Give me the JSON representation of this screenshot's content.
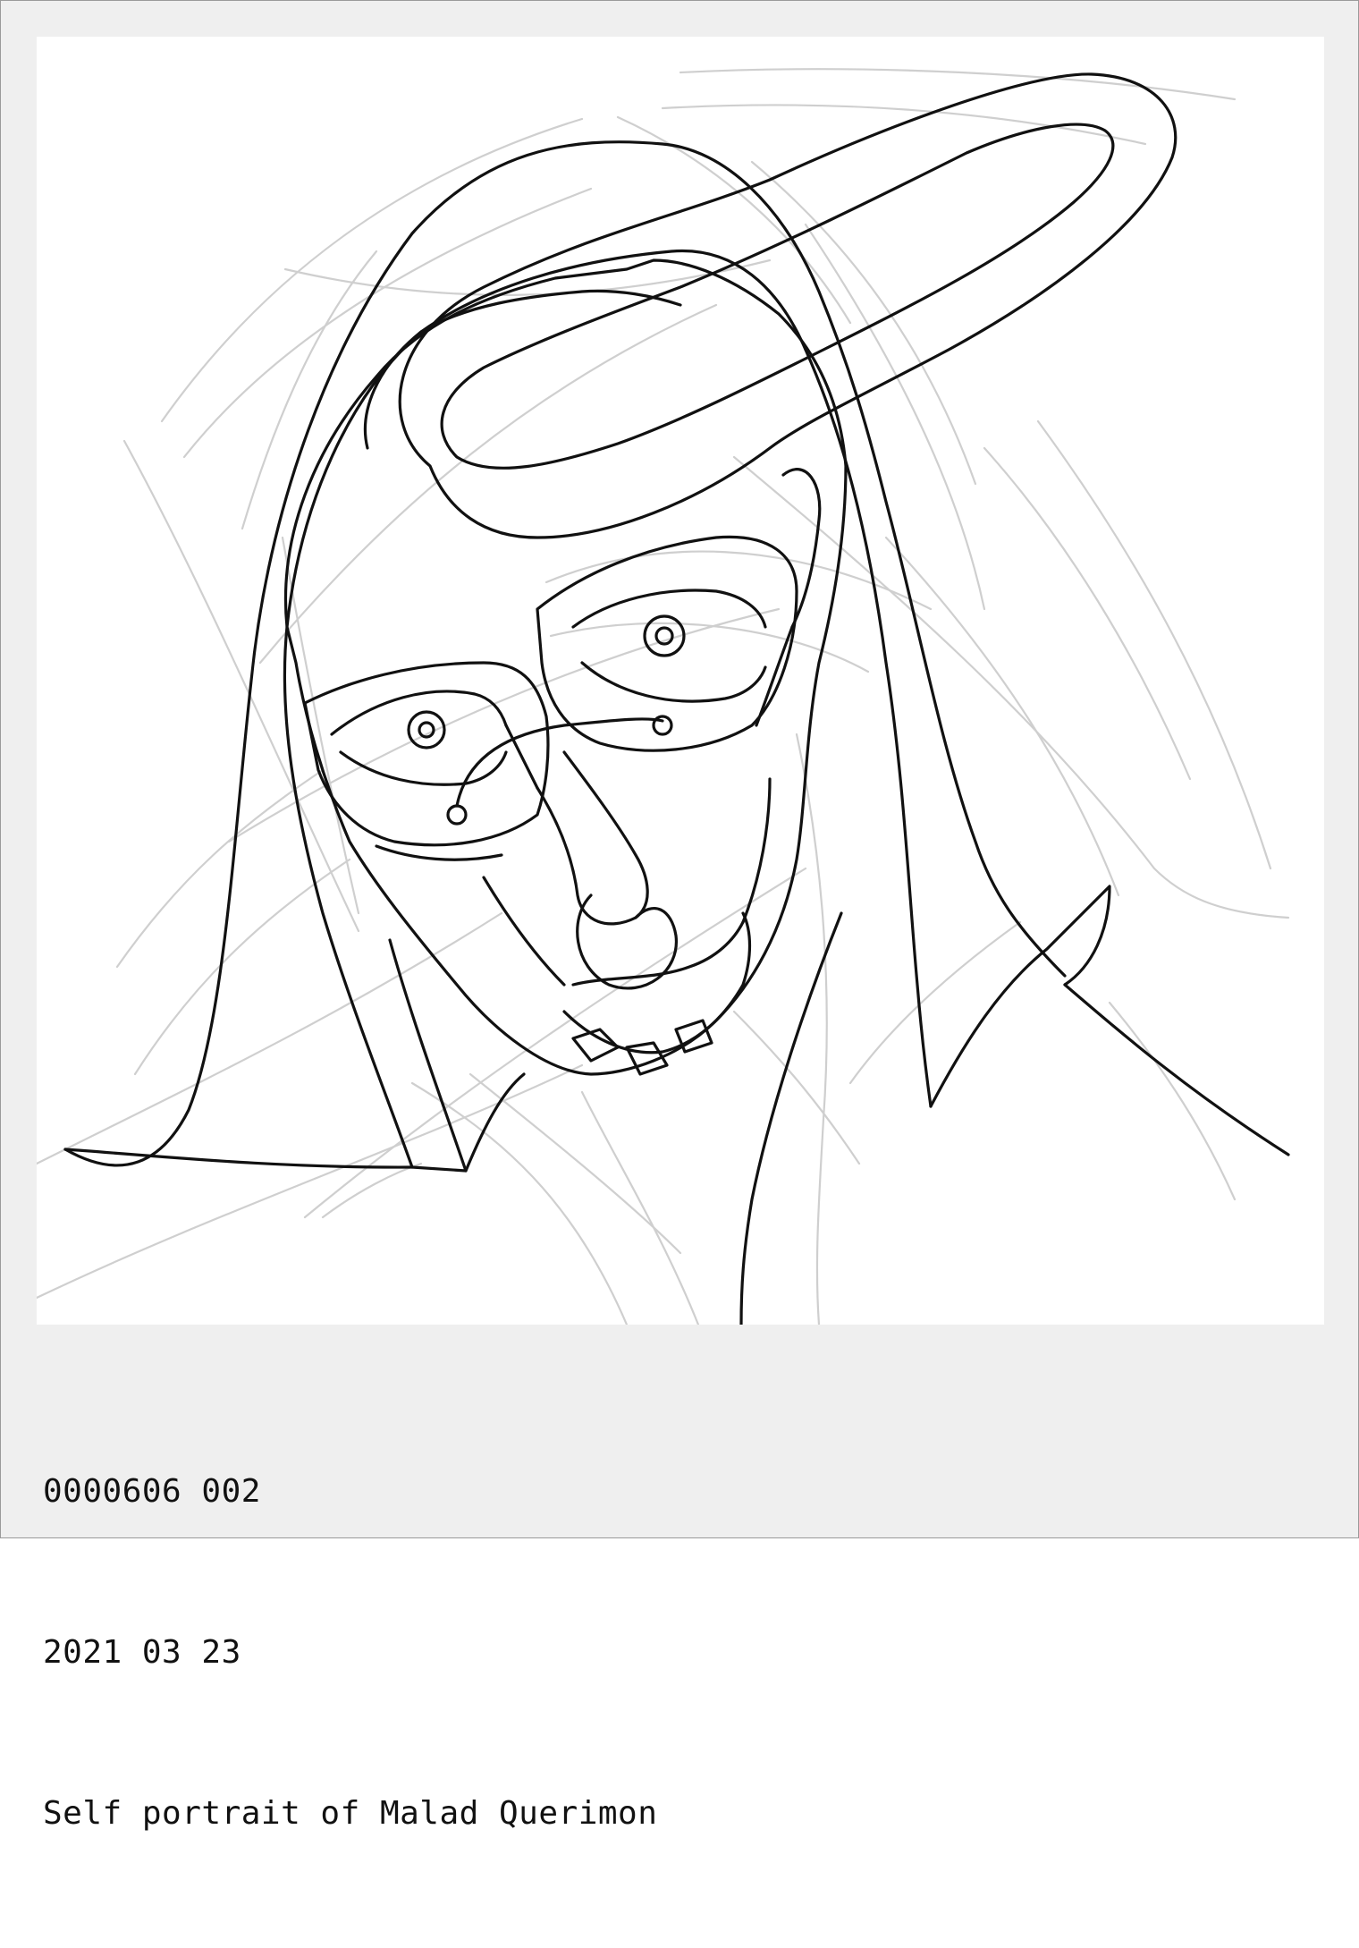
{
  "artwork": {
    "subject": "line drawing portrait"
  },
  "caption": {
    "id_line": "0000606 002",
    "date_line": "2021 03 23",
    "title_line": "Self portrait of Malad Querimon"
  },
  "colors": {
    "frame_background": "#efefef",
    "frame_border": "#9a9a9a",
    "canvas_background": "#ffffff",
    "ink": "#111111",
    "sketch_lines": "#cfcfcf"
  }
}
